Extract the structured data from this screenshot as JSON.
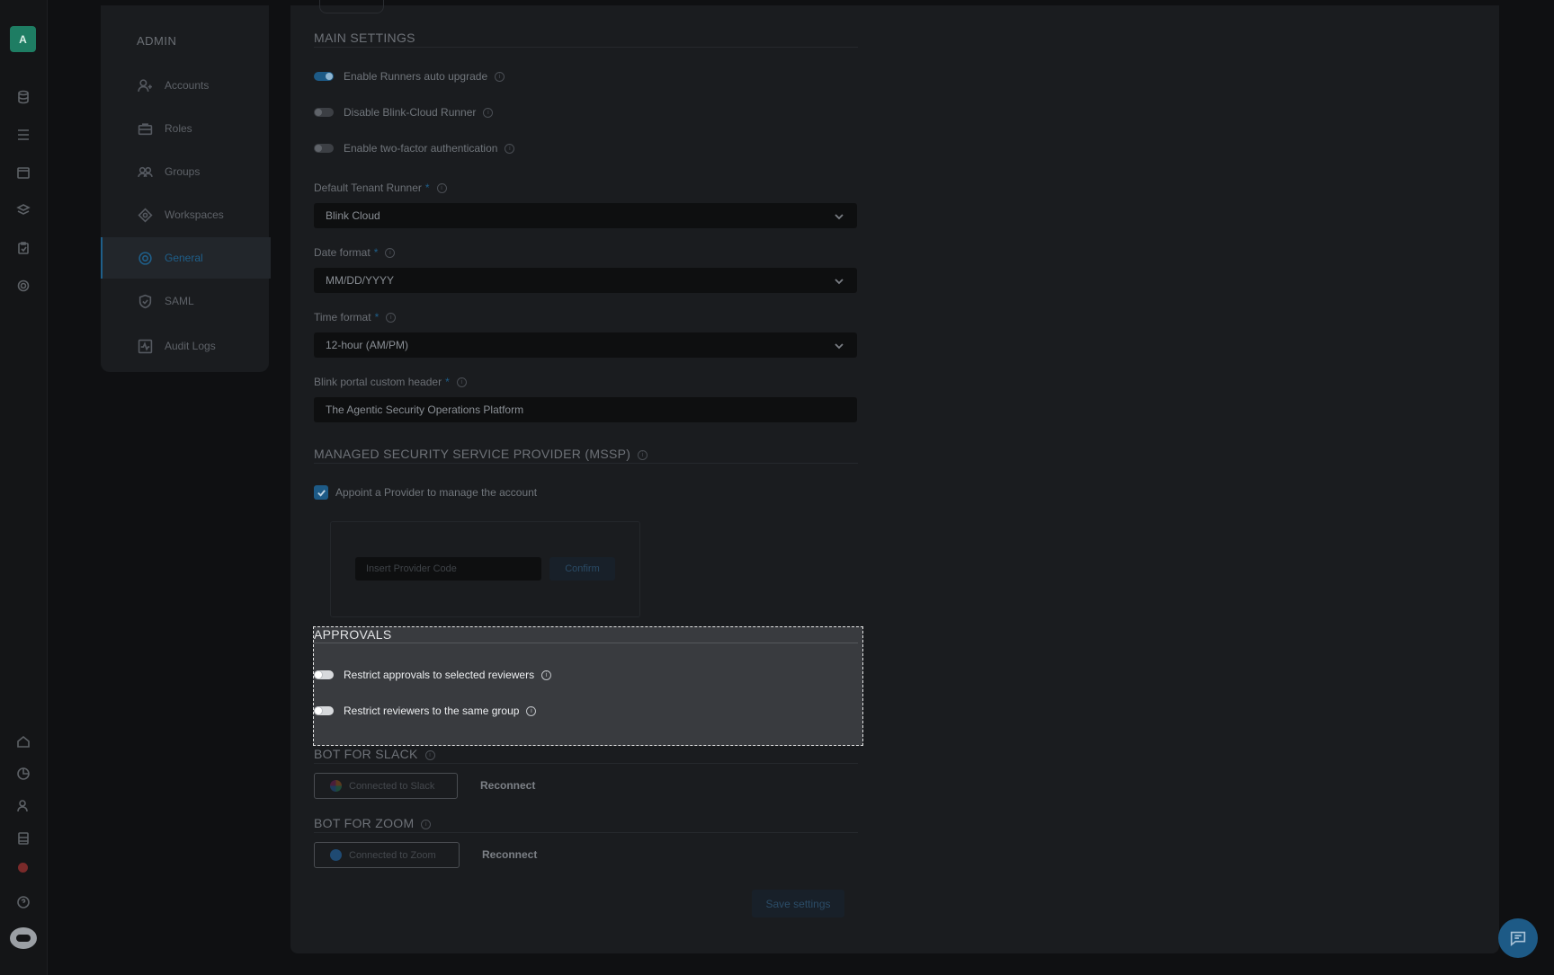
{
  "app": {
    "avatar_letter": "A"
  },
  "admin_menu": {
    "title": "ADMIN",
    "items": [
      {
        "label": "Accounts",
        "icon": "users-icon"
      },
      {
        "label": "Roles",
        "icon": "briefcase-icon"
      },
      {
        "label": "Groups",
        "icon": "group-icon"
      },
      {
        "label": "Workspaces",
        "icon": "workspace-icon"
      },
      {
        "label": "General",
        "icon": "gear-icon",
        "active": true
      },
      {
        "label": "SAML",
        "icon": "shield-icon"
      },
      {
        "label": "Audit Logs",
        "icon": "activity-icon"
      }
    ]
  },
  "main_settings": {
    "title": "MAIN SETTINGS",
    "toggles": [
      {
        "label": "Enable Runners auto upgrade",
        "on": true
      },
      {
        "label": "Disable Blink-Cloud Runner",
        "on": false
      },
      {
        "label": "Enable two-factor authentication",
        "on": false
      }
    ],
    "default_runner": {
      "label": "Default Tenant Runner",
      "required": "*",
      "value": "Blink Cloud"
    },
    "date_format": {
      "label": "Date format",
      "required": "*",
      "value": "MM/DD/YYYY"
    },
    "time_format": {
      "label": "Time format",
      "required": "*",
      "value": "12-hour (AM/PM)"
    },
    "portal_header": {
      "label": "Blink portal custom header",
      "required": "*",
      "value": "The Agentic Security Operations Platform"
    }
  },
  "mssp": {
    "title": "MANAGED SECURITY SERVICE PROVIDER (MSSP)",
    "checkbox_label": "Appoint a Provider to manage the account",
    "provider_placeholder": "Insert Provider Code",
    "confirm_label": "Confirm"
  },
  "approvals": {
    "title": "APPROVALS",
    "toggles": [
      {
        "label": "Restrict approvals to selected reviewers",
        "on": false
      },
      {
        "label": "Restrict reviewers to the same group",
        "on": false
      }
    ]
  },
  "slack": {
    "title": "BOT FOR SLACK",
    "button_label": "Connected to Slack",
    "reconnect_label": "Reconnect"
  },
  "zoom": {
    "title": "BOT FOR ZOOM",
    "button_label": "Connected to Zoom",
    "reconnect_label": "Reconnect"
  },
  "save_label": "Save settings",
  "colors": {
    "accent": "#1d5a86",
    "highlight_bg": "#393b3f",
    "success": "#1e7d63"
  }
}
